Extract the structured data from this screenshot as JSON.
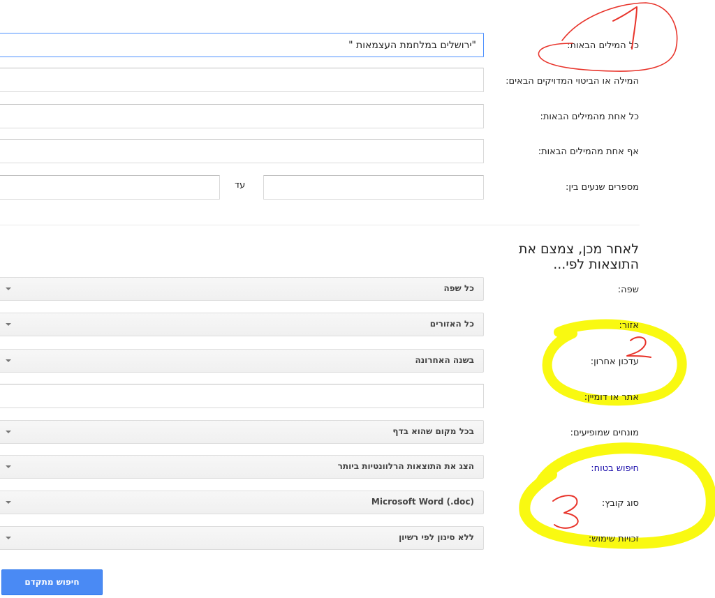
{
  "find_pages": {
    "all_words": {
      "label": "כל המילים הבאות:",
      "value": "\"ירושלים במלחמת העצמאות \""
    },
    "exact_phrase": {
      "label": "המילה או הביטוי המדויקים הבאים:",
      "value": ""
    },
    "any_words": {
      "label": "כל אחת מהמילים הבאות:",
      "value": ""
    },
    "none_words": {
      "label": "אף אחת מהמילים הבאות:",
      "value": ""
    },
    "numbers_range": {
      "label": "מספרים שנעים בין:",
      "from_value": "",
      "to_label": "עד",
      "to_value": ""
    }
  },
  "narrow": {
    "heading": "לאחר מכן, צמצם את התוצאות לפי...",
    "language": {
      "label": "שפה:",
      "selected": "כל שפה"
    },
    "region": {
      "label": "אזור:",
      "selected": "כל האזורים"
    },
    "last_update": {
      "label": "עדכון אחרון:",
      "selected": "בשנה האחרונה"
    },
    "site_domain": {
      "label": "אתר או דומיין:",
      "value": ""
    },
    "terms_appearing": {
      "label": "מונחים שמופיעים:",
      "selected": "בכל מקום שהוא בדף"
    },
    "safesearch": {
      "label": "חיפוש בטוח:",
      "selected": "הצג את התוצאות הרלוונטיות ביותר"
    },
    "file_type": {
      "label": "סוג קובץ:",
      "selected": "Microsoft Word (.doc)"
    },
    "usage_rights": {
      "label": "זכויות שימוש:",
      "selected": "ללא סינון לפי רשיון"
    }
  },
  "submit": {
    "label": "חיפוש מתקדם"
  },
  "annotations": {
    "marks": [
      "1",
      "2",
      "3"
    ],
    "colors": {
      "red": "#e8332a",
      "yellow": "#f9f904"
    }
  }
}
